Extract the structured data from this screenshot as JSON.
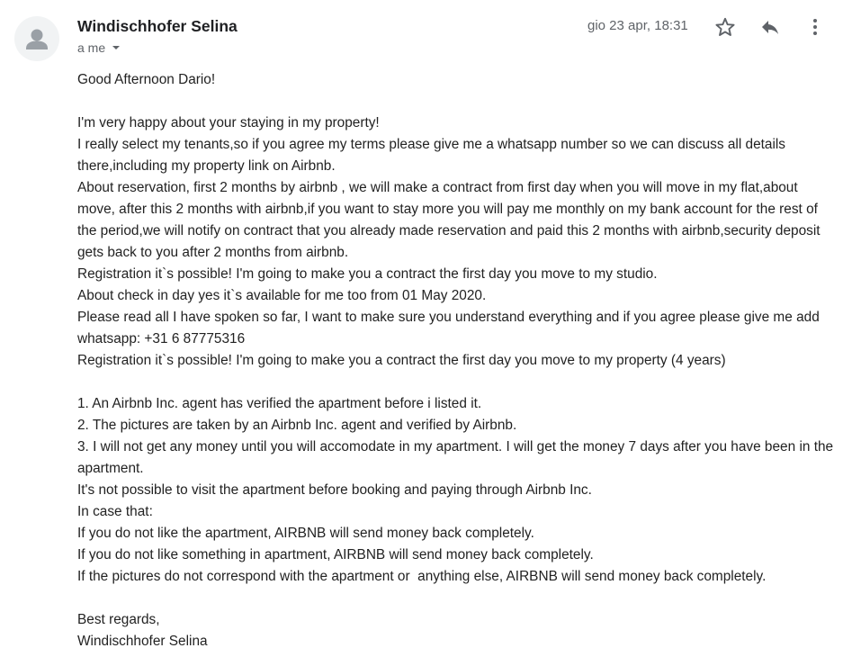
{
  "header": {
    "sender_name": "Windischhofer Selina",
    "recipient": "a me",
    "timestamp": "gio 23 apr, 18:31",
    "icons": {
      "avatar": "person-icon",
      "recipient_toggle": "caret-down-icon",
      "star": "star-icon",
      "reply": "reply-icon",
      "more": "more-vert-icon"
    }
  },
  "body": {
    "greeting": "Good Afternoon Dario!",
    "paragraph1": [
      "I'm very happy about your staying in my property!",
      "I really select my tenants,so if you agree my terms please give me a whatsapp number so we can discuss all details there,including my property link on Airbnb.",
      "About reservation, first 2 months by airbnb , we will make a contract from first day when you will move in my flat,about move, after this 2 months with airbnb,if you want to stay more you will pay me monthly on my bank account for the rest of the period,we will notify on contract that you already made reservation and paid this 2 months with airbnb,security deposit gets back to you after 2 months from airbnb.",
      "Registration it`s possible! I'm going to make you a contract the first day you move to my studio.",
      "About check in day yes it`s available for me too from 01 May 2020.",
      "Please read all I have spoken so far, I want to make sure you understand everything and if you agree please give me add whatsapp: +31 6 87775316",
      "Registration it`s possible! I'm going to make you a contract the first day you move to my property (4 years)"
    ],
    "paragraph2": [
      "1. An Airbnb Inc. agent has verified the apartment before i listed it.",
      "2. The pictures are taken by an Airbnb Inc. agent and verified by Airbnb.",
      "3. I will not get any money until you will accomodate in my apartment. I will get the money 7 days after you have been in the apartment.",
      "It's not possible to visit the apartment before booking and paying through Airbnb Inc.",
      "In case that:",
      "If you do not like the apartment, AIRBNB will send money back completely.",
      "If you do not like something in apartment, AIRBNB will send money back completely.",
      "If the pictures do not correspond with the apartment or  anything else, AIRBNB will send money back completely."
    ],
    "closing": "Best regards,",
    "signature": "Windischhofer Selina"
  }
}
